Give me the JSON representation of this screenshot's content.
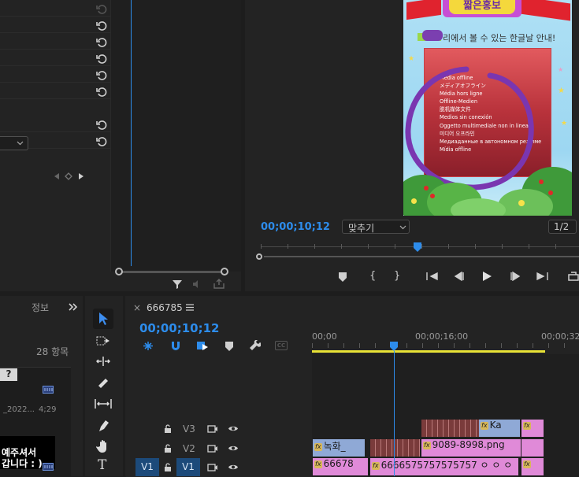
{
  "effect_controls": {
    "scroll_value": "0"
  },
  "program_monitor": {
    "timecode": "00;00;10;12",
    "fit_select": "맞추기",
    "resolution": "1/2",
    "video": {
      "banner": "짧은홍보",
      "subtitle": "리에서 볼 수 있는 한글날 안내!",
      "offline_lines": [
        "Media offline",
        "メディアオフライン",
        "Média hors ligne",
        "Offline-Medien",
        "脱机媒体文件",
        "Medios sin conexión",
        "Oggetto multimediale non in linea",
        "미디어 오프라인",
        "Медиаданные в автономном режиме",
        "Mídia offline"
      ]
    }
  },
  "project_panel": {
    "tab": "정보",
    "item_count": "28 항목",
    "file_name": "_2022...",
    "duration": "4;29",
    "thumb_text_1": "예주셔서",
    "thumb_text_2": "갑니다 : )",
    "badge": "?"
  },
  "timeline": {
    "sequence_name": "666785",
    "timecode": "00;00;10;12",
    "ruler": [
      "00;00",
      "00;00;16;00",
      "00;00;32"
    ],
    "tracks": [
      {
        "label": "V3"
      },
      {
        "label": "V2"
      },
      {
        "label": "V1",
        "source": "V1"
      }
    ],
    "clips": {
      "v3_text": "Ka",
      "v2_text_a": "녹화_",
      "v2_text_b": "9089-8998.png",
      "v1_text_a": "66678",
      "v1_text_b": "6666575757575757 ㅇ ㅇ ㅇ"
    }
  },
  "colors": {
    "accent_blue": "#2d8ceb",
    "clip_pink": "#e08ad8",
    "clip_blue": "#8fa9d6",
    "work_area_yellow": "#e8e236"
  }
}
